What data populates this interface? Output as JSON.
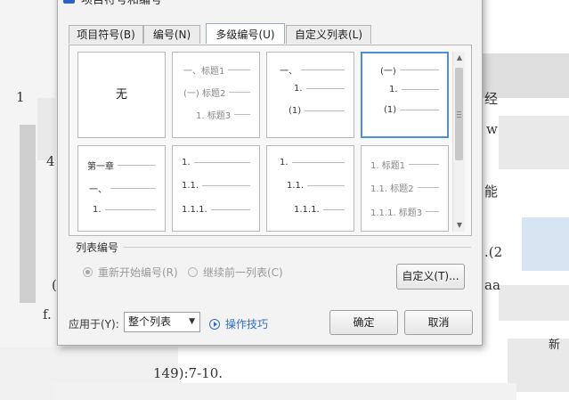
{
  "dialog": {
    "title": "项目符号和编号",
    "logo": "W"
  },
  "tabs": [
    {
      "label": "项目符号(B)"
    },
    {
      "label": "编号(N)"
    },
    {
      "label": "多级编号(U)"
    },
    {
      "label": "自定义列表(L)"
    }
  ],
  "active_tab": "多级编号(U)",
  "gallery": {
    "none_label": "无",
    "cells": [
      {
        "lines": [
          "一、标题1",
          "(一) 标题2",
          "1. 标题3"
        ]
      },
      {
        "lines": [
          "一、",
          "1.",
          "(1)"
        ]
      },
      {
        "lines": [
          "(一)",
          "1.",
          "(1)"
        ]
      },
      {
        "lines": [
          "第一章",
          "一、",
          "1."
        ]
      },
      {
        "lines": [
          "1.",
          "1.1.",
          "1.1.1."
        ]
      },
      {
        "lines": [
          "1.",
          "1.1.",
          "1.1.1."
        ]
      },
      {
        "lines": [
          "1. 标题1",
          "1.1. 标题2",
          "1.1.1. 标题3"
        ]
      }
    ],
    "selected_index": 3
  },
  "list_numbering": {
    "label": "列表编号",
    "restart": "重新开始编号(R)",
    "continue": "继续前一列表(C)",
    "custom_button": "自定义(T)..."
  },
  "footer": {
    "apply_label": "应用于(Y):",
    "apply_value": "整个列表",
    "tips": "操作技巧",
    "ok": "确定",
    "cancel": "取消"
  },
  "document": {
    "frag1": "1",
    "frag2": "经",
    "frag3": "w",
    "frag4": "能",
    "frag5": ".(2",
    "frag6": "aa",
    "frag7": "f.",
    "frag8": "149):7-10.",
    "frag9": "新",
    "frag10": "(",
    "frag11": "4"
  }
}
